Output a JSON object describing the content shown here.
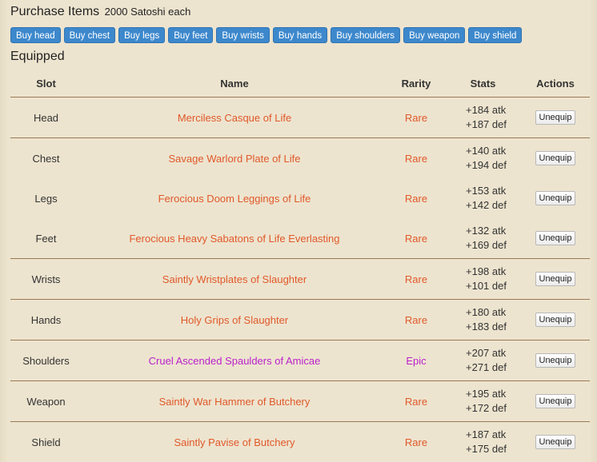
{
  "header": {
    "title": "Purchase Items",
    "price_note": "2000 Satoshi each"
  },
  "buy_buttons": [
    "Buy head",
    "Buy chest",
    "Buy legs",
    "Buy feet",
    "Buy wrists",
    "Buy hands",
    "Buy shoulders",
    "Buy weapon",
    "Buy shield"
  ],
  "equipped": {
    "title": "Equipped",
    "columns": [
      "Slot",
      "Name",
      "Rarity",
      "Stats",
      "Actions"
    ],
    "action_label": "Unequip",
    "colors": {
      "rare": "#e0592a",
      "epic": "#bb22cc",
      "button_blue": "#3d88cc"
    },
    "rows": [
      {
        "slot": "Head",
        "name": "Merciless Casque of Life",
        "rarity": "Rare",
        "atk": "+184 atk",
        "def": "+187 def"
      },
      {
        "slot": "Chest",
        "name": "Savage Warlord Plate of Life",
        "rarity": "Rare",
        "atk": "+140 atk",
        "def": "+194 def"
      },
      {
        "slot": "Legs",
        "name": "Ferocious Doom Leggings of Life",
        "rarity": "Rare",
        "atk": "+153 atk",
        "def": "+142 def"
      },
      {
        "slot": "Feet",
        "name": "Ferocious Heavy Sabatons of Life Everlasting",
        "rarity": "Rare",
        "atk": "+132 atk",
        "def": "+169 def"
      },
      {
        "slot": "Wrists",
        "name": "Saintly Wristplates of Slaughter",
        "rarity": "Rare",
        "atk": "+198 atk",
        "def": "+101 def"
      },
      {
        "slot": "Hands",
        "name": "Holy Grips of Slaughter",
        "rarity": "Rare",
        "atk": "+180 atk",
        "def": "+183 def"
      },
      {
        "slot": "Shoulders",
        "name": "Cruel Ascended Spaulders of Amicae",
        "rarity": "Epic",
        "atk": "+207 atk",
        "def": "+271 def"
      },
      {
        "slot": "Weapon",
        "name": "Saintly War Hammer of Butchery",
        "rarity": "Rare",
        "atk": "+195 atk",
        "def": "+172 def"
      },
      {
        "slot": "Shield",
        "name": "Saintly Pavise of Butchery",
        "rarity": "Rare",
        "atk": "+187 atk",
        "def": "+175 def"
      }
    ]
  }
}
